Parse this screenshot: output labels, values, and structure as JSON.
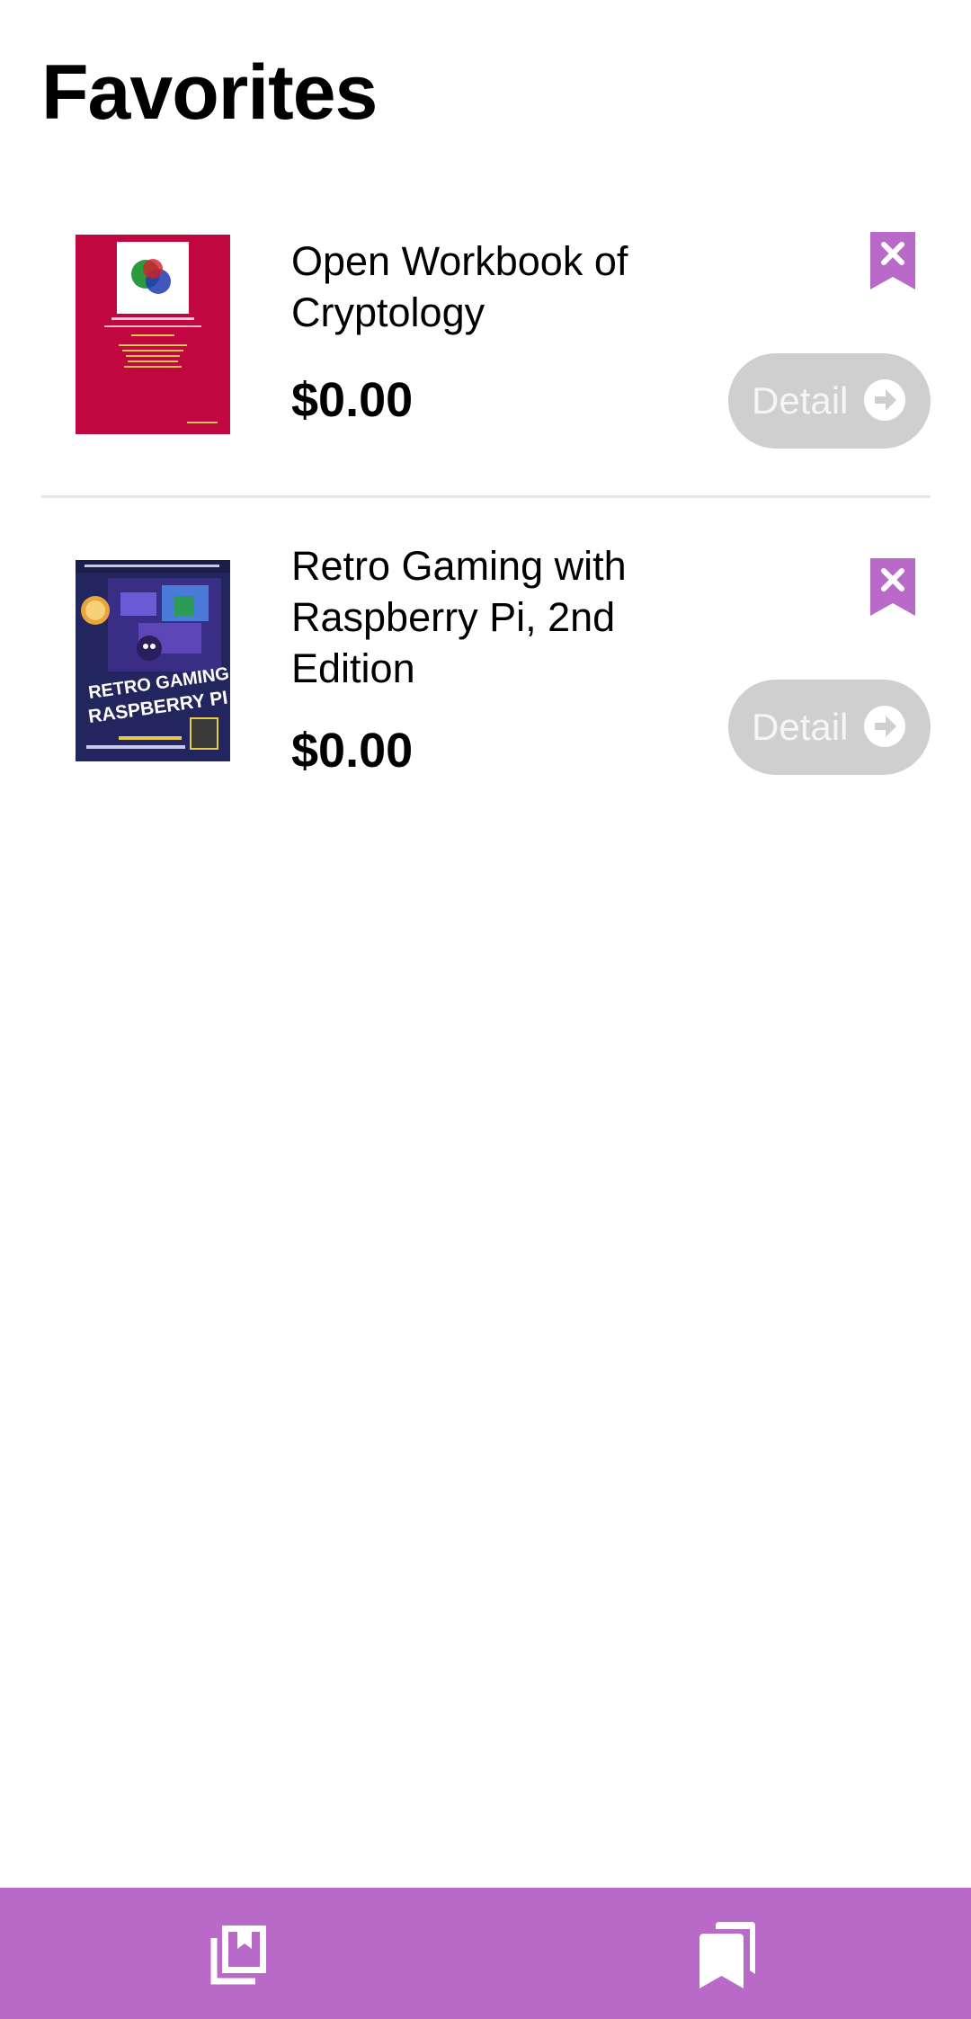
{
  "page": {
    "title": "Favorites"
  },
  "favorites": [
    {
      "title": "Open Workbook of Cryptology",
      "price": "$0.00",
      "detail_label": "Detail",
      "cover_icon": "book-cover-cryptology"
    },
    {
      "title": "Retro Gaming with Raspberry Pi, 2nd Edition",
      "price": "$0.00",
      "detail_label": "Detail",
      "cover_icon": "book-cover-retro-gaming"
    }
  ],
  "icons": {
    "remove": "bookmark-remove-icon",
    "detail": "arrow-right-circle-icon",
    "nav_left": "library-books-icon",
    "nav_right": "bookmarks-icon"
  },
  "colors": {
    "accent": "#b96ac9",
    "detail_button": "#cfcfcf",
    "divider": "#e6e6e6"
  }
}
